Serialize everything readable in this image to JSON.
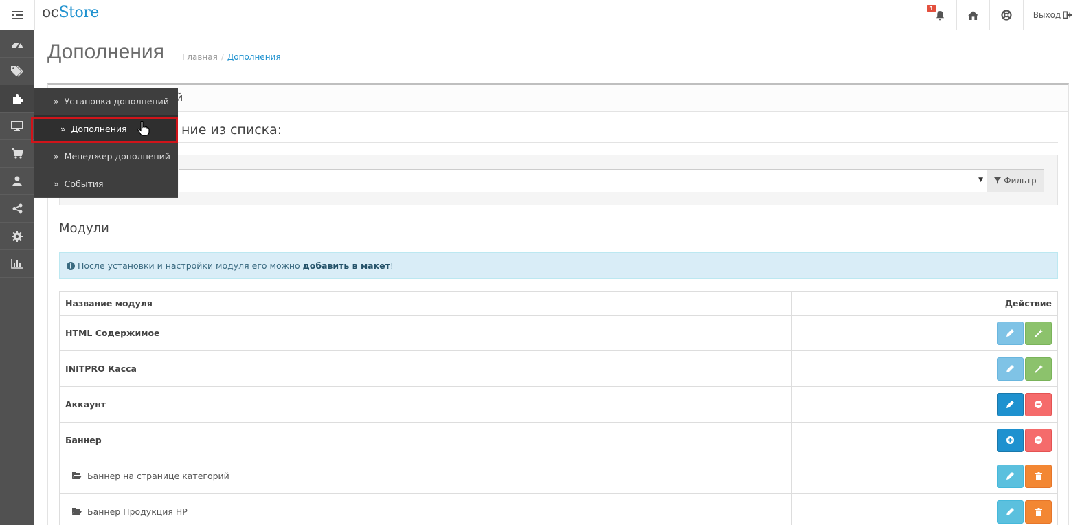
{
  "header": {
    "logo_oc": "oc",
    "logo_store": "Store",
    "notification_count": "1",
    "logout_label": "Выход"
  },
  "sidebar": {
    "icons": [
      "dashboard-icon",
      "tags-icon",
      "puzzle-icon",
      "desktop-icon",
      "cart-icon",
      "user-icon",
      "share-icon",
      "cog-icon",
      "bar-chart-icon"
    ]
  },
  "flyout": {
    "items": [
      {
        "label": "Установка дополнений"
      },
      {
        "label": "Дополнения"
      },
      {
        "label": "Менеджер дополнений"
      },
      {
        "label": "События"
      }
    ]
  },
  "page": {
    "title": "Дополнения",
    "breadcrumb": [
      "Главная",
      "Дополнения"
    ],
    "panel_heading_tail": "й",
    "choose_title_tail": "ние из списка:",
    "filter_label": "Фильтр",
    "modules_title": "Модули",
    "alert_text": "После установки и настройки модуля его можно ",
    "alert_bold": "добавить в макет",
    "alert_end": "!"
  },
  "table": {
    "headers": [
      "Название модуля",
      "Действие"
    ],
    "rows": [
      {
        "name": "HTML Содержимое"
      },
      {
        "name": "INITPRO Касса"
      },
      {
        "name": "Аккаунт"
      },
      {
        "name": "Баннер"
      },
      {
        "name": "Баннер на странице категорий"
      },
      {
        "name": "Баннер Продукция НР"
      }
    ]
  },
  "colors": {
    "sidebar": "#515151",
    "flyout": "#3e3e3e",
    "highlight": "#d0141a",
    "primary": "#1e91cf",
    "danger": "#f56b6b",
    "warning": "#f38733",
    "success": "#8cc26c",
    "alert_bg": "#d9edf7"
  }
}
